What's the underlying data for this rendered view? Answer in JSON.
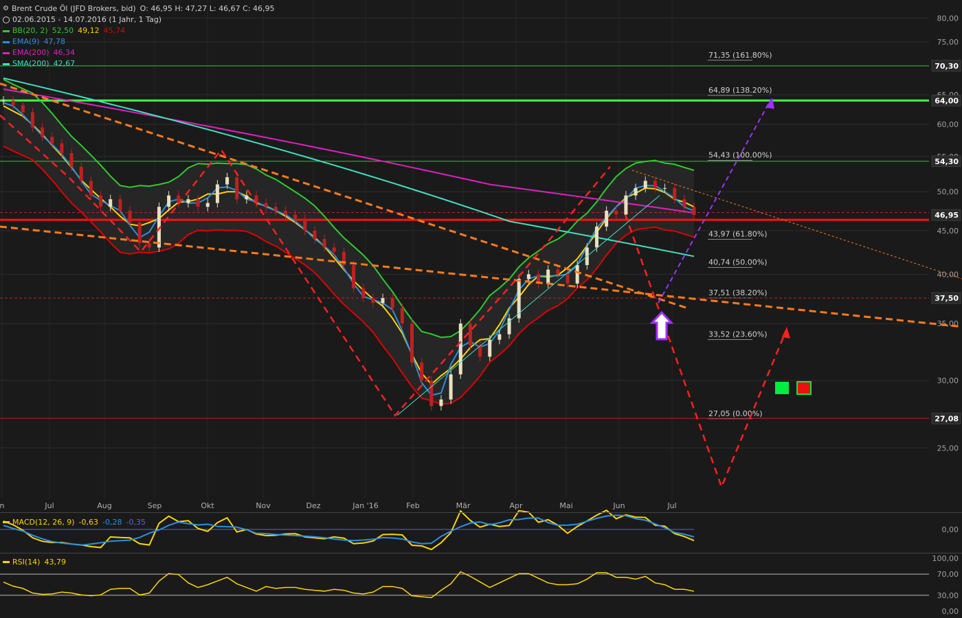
{
  "header": {
    "instrument": "Brent Crude Öl (JFD Brokers, bid)",
    "ohlc": "O: 46,95  H: 47,27  L: 46,67  C: 46,95",
    "range": "02.06.2015 - 14.07.2016 (1 Jahr, 1 Tag)"
  },
  "indicators": [
    {
      "label": "BB(20, 2)",
      "color": "#2ecc2e",
      "values": [
        {
          "text": "52,50",
          "color": "#2ecc2e"
        },
        {
          "text": "49,12",
          "color": "#ffd400"
        },
        {
          "text": "45,74",
          "color": "#e00000"
        }
      ]
    },
    {
      "label": "EMA(9)",
      "color": "#2c8fe0",
      "values": [
        {
          "text": "47,78",
          "color": "#2c8fe0"
        }
      ]
    },
    {
      "label": "EMA(200)",
      "color": "#e020c0",
      "values": [
        {
          "text": "46,34",
          "color": "#e020c0"
        }
      ]
    },
    {
      "label": "SMA(200)",
      "color": "#40e0c0",
      "values": [
        {
          "text": "42,67",
          "color": "#40e0c0"
        }
      ]
    }
  ],
  "macd_legend": {
    "label": "MACD(12, 26, 9)",
    "values": [
      {
        "text": "-0,63",
        "color": "#ffd400"
      },
      {
        "text": "-0,28",
        "color": "#2c8fe0"
      },
      {
        "text": "-0,35",
        "color": "#6060e0"
      }
    ]
  },
  "rsi_legend": {
    "label": "RSI(14)",
    "value": "43,79"
  },
  "colors": {
    "background": "#1a1a1a",
    "up": "#e8e0c0",
    "down": "#c02020",
    "bb_upper": "#2ecc2e",
    "bb_mid": "#ffd400",
    "bb_lower": "#e00000",
    "ema9": "#2c8fe0",
    "ema200": "#e020c0",
    "sma200": "#40e0c0",
    "trend": "#ff7a1a",
    "red_dash": "#ff2020",
    "purple": "#a030ff"
  },
  "chart_data": {
    "type": "line",
    "title": "Brent Crude Öl (JFD Brokers, bid)",
    "yscale": "log",
    "ylim": [
      21.8,
      84
    ],
    "x_tick_labels": [
      "n",
      "Jul",
      "Aug",
      "Sep",
      "Okt",
      "Nov",
      "Dez",
      "Jan '16",
      "Feb",
      "Mär",
      "Apr",
      "Mai",
      "Jun",
      "Jul"
    ],
    "y_tick_labels": [
      "80,00",
      "75,00",
      "70,30",
      "65,00",
      "64,00",
      "60,00",
      "55,00",
      "54,30",
      "50,00",
      "46,95",
      "45,00",
      "40,00",
      "37,50",
      "35,00",
      "30,00",
      "27,08",
      "25,00"
    ],
    "y_ticks": [
      80,
      75,
      65,
      60,
      55,
      50,
      45,
      40,
      35,
      30,
      25
    ],
    "highlighted_levels": [
      {
        "value": 70.3,
        "label": "70,30",
        "color": "#2ecc2e",
        "bg": "#2a2a2a"
      },
      {
        "value": 64.0,
        "label": "64,00",
        "color": "#2ecc2e",
        "bg": "#2a2a2a"
      },
      {
        "value": 54.3,
        "label": "54,30",
        "color": "#2ecc2e",
        "bg": "#2a2a2a"
      },
      {
        "value": 46.95,
        "label": "46,95",
        "color": "#ffffff",
        "bg": "#2a2a2a"
      },
      {
        "value": 37.5,
        "label": "37,50",
        "color": "#e00000",
        "bg": "#2a2a2a"
      },
      {
        "value": 27.08,
        "label": "27,08",
        "color": "#e00000",
        "bg": "#2a2a2a"
      }
    ],
    "fibonacci": [
      {
        "value": 71.35,
        "label": "71,35 (161.80%)"
      },
      {
        "value": 64.89,
        "label": "64,89 (138.20%)"
      },
      {
        "value": 54.43,
        "label": "54,43 (100.00%)"
      },
      {
        "value": 43.97,
        "label": "43,97 (61.80%)"
      },
      {
        "value": 40.74,
        "label": "40,74 (50.00%)"
      },
      {
        "value": 37.51,
        "label": "37,51 (38.20%)"
      },
      {
        "value": 33.52,
        "label": "33,52 (23.60%)"
      },
      {
        "value": 27.05,
        "label": "27,05 (0.00%)"
      }
    ],
    "close": [
      64.0,
      63.2,
      62.0,
      59.5,
      58.0,
      57.0,
      55.5,
      53.5,
      51.5,
      49.5,
      48.0,
      49.0,
      47.5,
      46.0,
      43.5,
      43.0,
      48.0,
      49.5,
      48.5,
      49.0,
      48.0,
      48.5,
      51.0,
      52.0,
      49.0,
      49.5,
      48.5,
      48.0,
      47.5,
      47.0,
      46.5,
      45.0,
      44.0,
      43.0,
      42.5,
      41.0,
      38.5,
      37.5,
      37.0,
      37.5,
      36.5,
      35.0,
      31.5,
      30.0,
      28.0,
      28.5,
      30.5,
      35.0,
      33.0,
      32.0,
      33.5,
      34.0,
      35.5,
      39.5,
      40.0,
      39.0,
      40.5,
      40.0,
      39.0,
      41.0,
      43.0,
      45.5,
      47.5,
      47.0,
      49.5,
      50.5,
      51.5,
      50.5,
      50.5,
      49.0,
      48.0,
      46.95
    ]
  },
  "macd_axis": {
    "label": "0,00"
  },
  "rsi_axis": {
    "labels": [
      "100,00",
      "70,00",
      "30,00",
      "0,00"
    ]
  }
}
